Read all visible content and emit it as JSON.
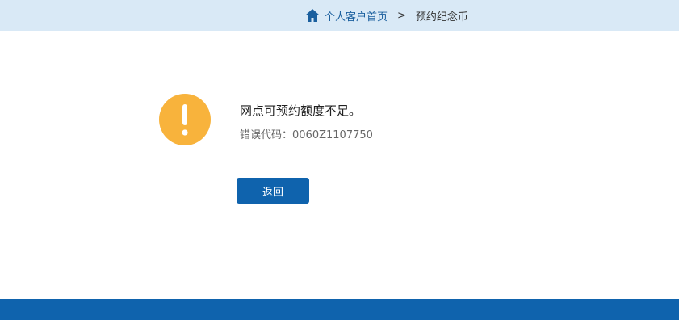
{
  "breadcrumb": {
    "home_icon": "home-icon",
    "home_label": "个人客户首页",
    "separator": ">",
    "current_label": "预约纪念币"
  },
  "message": {
    "icon": "exclamation-icon",
    "title": "网点可预约额度不足。",
    "error_code_label": "错误代码：",
    "error_code": "0060Z1107750"
  },
  "actions": {
    "return_label": "返回"
  },
  "colors": {
    "topbar_bg": "#d9e9f6",
    "link": "#1a5f9e",
    "alert": "#f8b33c",
    "primary": "#0f63ad"
  }
}
